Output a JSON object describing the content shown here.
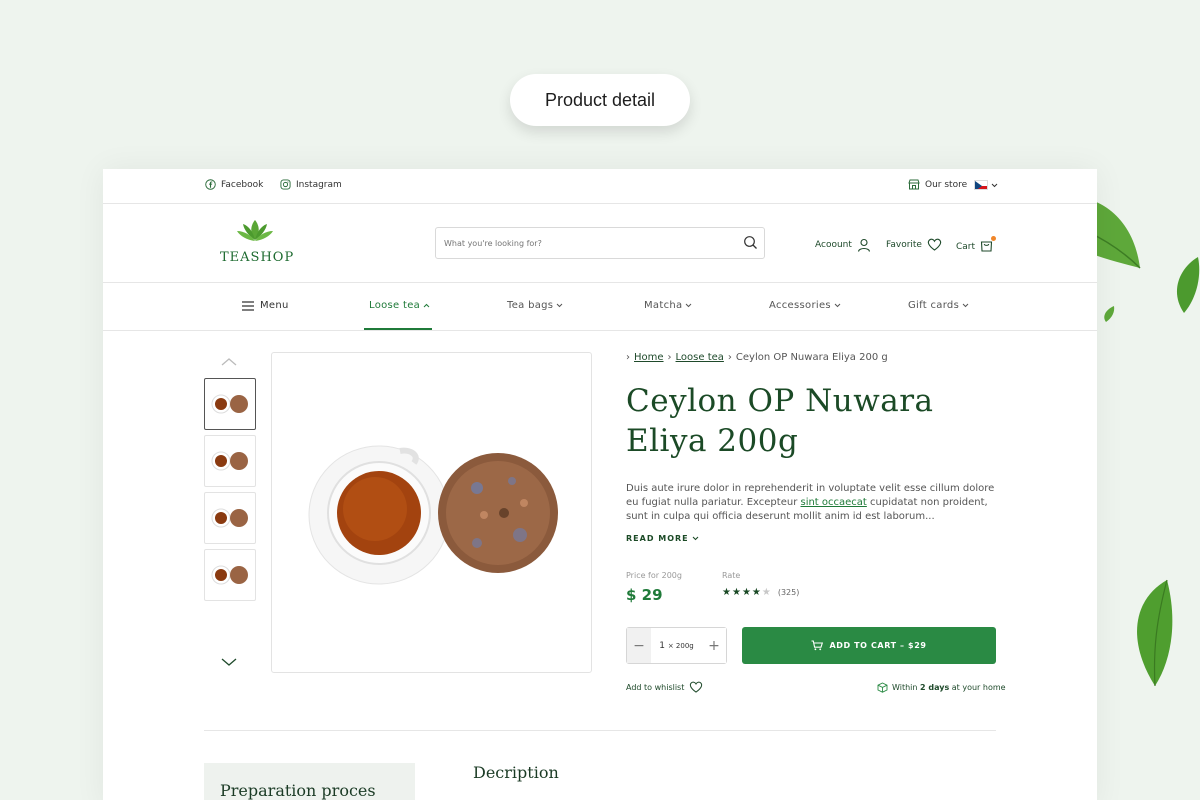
{
  "banner": {
    "label": "Product detail"
  },
  "topbar": {
    "facebook": "Facebook",
    "instagram": "Instagram",
    "store": "Our store"
  },
  "header": {
    "logo": "TEASHOP",
    "search_placeholder": "What you're looking for?",
    "account": "Acoount",
    "favorite": "Favorite",
    "cart": "Cart"
  },
  "nav": {
    "menu": "Menu",
    "items": [
      "Loose tea",
      "Tea bags",
      "Matcha",
      "Accessories",
      "Gift cards"
    ]
  },
  "breadcrumb": {
    "home": "Home",
    "category": "Loose tea",
    "current": "Ceylon OP Nuwara Eliya 200 g"
  },
  "product": {
    "title": "Ceylon OP Nuwara Eliya 200g",
    "desc_part1": "Duis aute irure dolor in reprehenderit in voluptate velit esse cillum dolore eu fugiat nulla pariatur. Excepteur ",
    "desc_link": "sint occaecat",
    "desc_part2": " cupidatat non proident, sunt in culpa qui officia deserunt mollit anim id est laborum...",
    "read_more": "READ MORE",
    "price_label": "Price for 200g",
    "price": "$ 29",
    "rate_label": "Rate",
    "rating": 4,
    "rating_max": 5,
    "rating_count": "(325)",
    "qty": "1",
    "qty_unit": "× 200g",
    "add_to_cart": "ADD TO CART – $29",
    "wishlist": "Add to whislist",
    "delivery_pre": "Within ",
    "delivery_days": "2 days",
    "delivery_post": " at your home"
  },
  "tabs": {
    "preparation": "Preparation proces",
    "description": "Decription"
  },
  "colors": {
    "primary": "#2a8a44",
    "dark_green": "#1b4a26",
    "background": "#eef4ee"
  }
}
